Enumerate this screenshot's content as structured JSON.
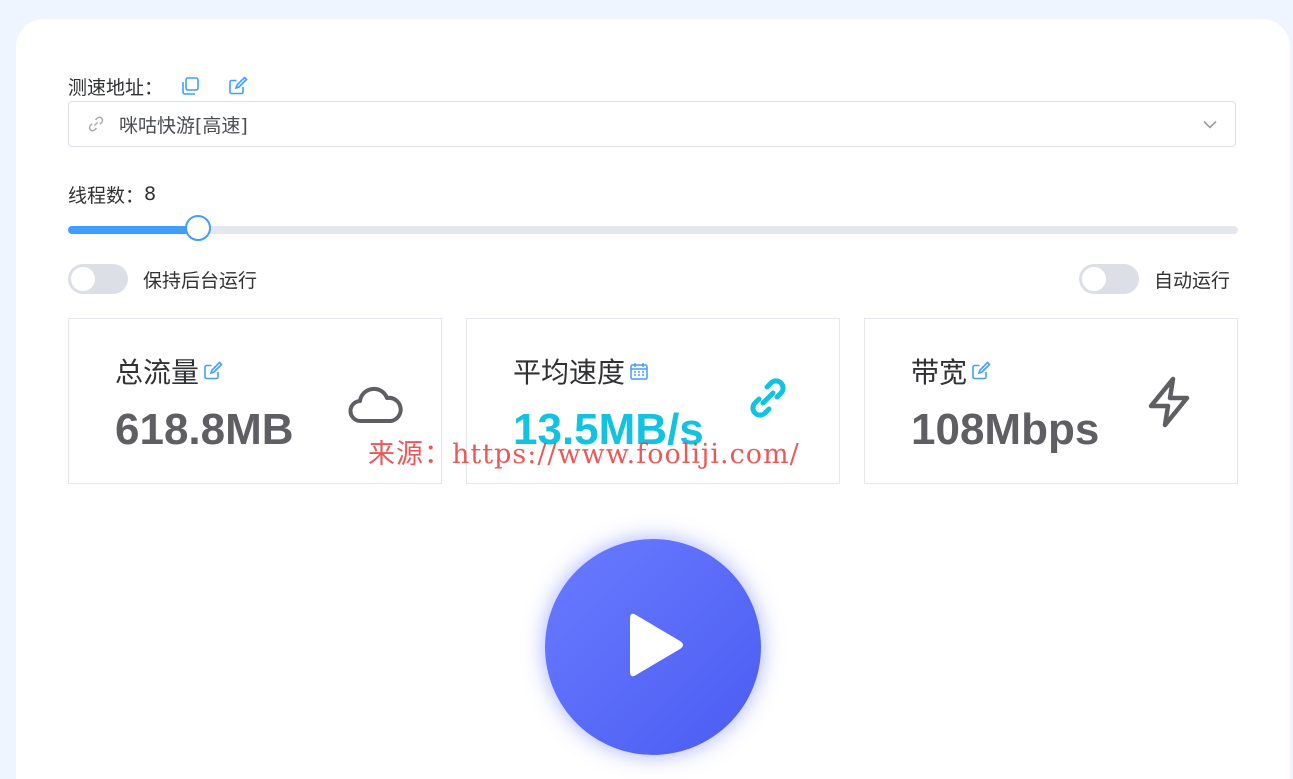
{
  "speedtest": {
    "address_label": "测速地址：",
    "selected_source": "咪咕快游[高速]"
  },
  "threads": {
    "label": "线程数：",
    "value": "8",
    "slider_fraction": 0.111
  },
  "toggles": {
    "background_label": "保持后台运行",
    "background_on": false,
    "auto_label": "自动运行",
    "auto_on": false
  },
  "stats": {
    "total": {
      "title": "总流量",
      "value": "618.8MB",
      "icon": "cloud-icon"
    },
    "avg": {
      "title": "平均速度",
      "value": "13.5MB/s",
      "icon": "link-icon"
    },
    "bandwidth": {
      "title": "带宽",
      "value": "108Mbps",
      "icon": "lightning-icon"
    }
  },
  "watermark": "来源：https://www.fooliji.com/",
  "colors": {
    "accent": "#409eff",
    "avg_value": "#13c2e0",
    "stat_value": "#5f5f63",
    "play_button": "#5a6cf8"
  }
}
